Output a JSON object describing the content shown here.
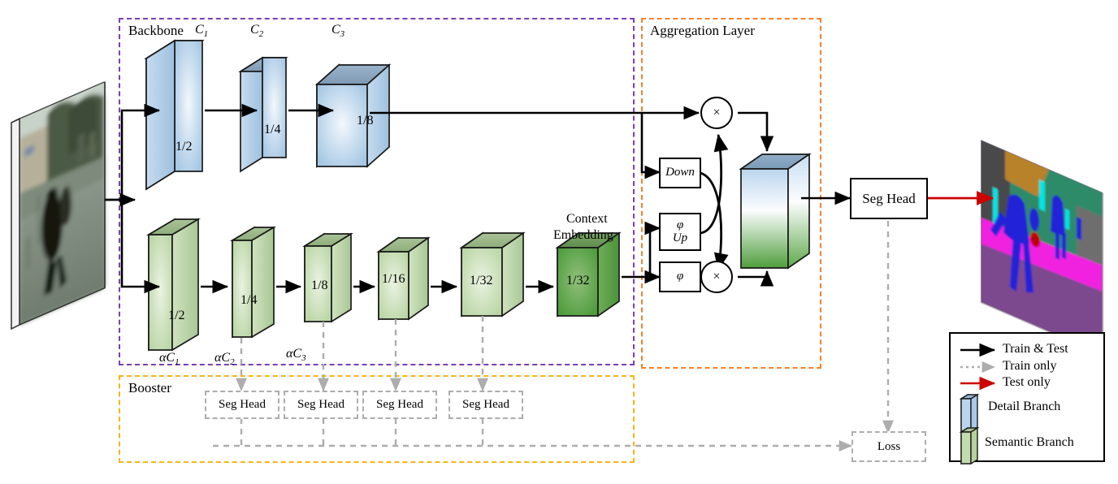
{
  "groups": {
    "backbone": {
      "label": "Backbone",
      "color": "#7B3FB5"
    },
    "aggregation": {
      "label": "Aggregation Layer",
      "color": "#F2822B"
    },
    "booster": {
      "label": "Booster",
      "color": "#F5B517"
    }
  },
  "detail_branch": {
    "name": "Detail Branch",
    "color": "#BBD5EE",
    "blocks": [
      {
        "channel": "C",
        "channel_sub": "1",
        "scale": "1/2"
      },
      {
        "channel": "C",
        "channel_sub": "2",
        "scale": "1/4"
      },
      {
        "channel": "C",
        "channel_sub": "3",
        "scale": "1/8"
      }
    ]
  },
  "semantic_branch": {
    "name": "Semantic Branch",
    "color": "#C3DCAF",
    "blocks": [
      {
        "channel": "αC",
        "channel_sub": "1",
        "scale": "1/2"
      },
      {
        "channel": "αC",
        "channel_sub": "2",
        "scale": "1/4"
      },
      {
        "channel": "αC",
        "channel_sub": "3",
        "scale": "1/8"
      },
      {
        "channel": "",
        "channel_sub": "",
        "scale": "1/16"
      },
      {
        "channel": "",
        "channel_sub": "",
        "scale": "1/32"
      }
    ],
    "context_embedding": {
      "label_line1": "Context",
      "label_line2": "Embedding",
      "scale": "1/32"
    }
  },
  "aggregation": {
    "ops": [
      {
        "id": "down",
        "line1": "Down",
        "line2": ""
      },
      {
        "id": "phi-up",
        "line1": "φ",
        "line2": "Up"
      },
      {
        "id": "phi",
        "line1": "φ",
        "line2": ""
      }
    ],
    "mul_symbol": "×",
    "fusion_cube": ""
  },
  "heads": {
    "main": "Seg Head",
    "booster": [
      "Seg Head",
      "Seg Head",
      "Seg Head",
      "Seg Head"
    ],
    "loss": "Loss"
  },
  "legend": {
    "rows": [
      {
        "kind": "arrow",
        "style": "solid",
        "color": "#000000",
        "label": "Train & Test"
      },
      {
        "kind": "arrow",
        "style": "dotted",
        "color": "#adadad",
        "label": "Train only"
      },
      {
        "kind": "arrow",
        "style": "solid",
        "color": "#CC0000",
        "label": "Test only"
      },
      {
        "kind": "swatch",
        "color": "#BBD5EE",
        "label": "Detail Branch"
      },
      {
        "kind": "swatch",
        "color": "#C3DCAF",
        "label": "Semantic Branch"
      }
    ]
  },
  "io": {
    "input_name": "input-street-image",
    "output_name": "output-segmentation-map"
  }
}
